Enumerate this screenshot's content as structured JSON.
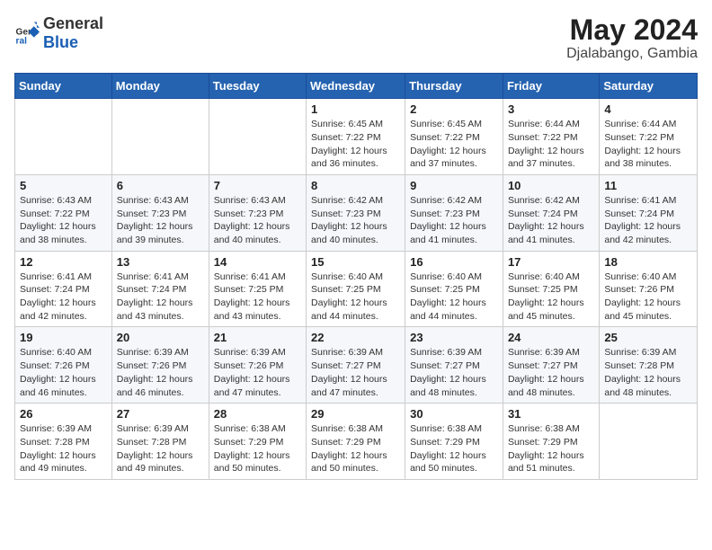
{
  "header": {
    "logo_general": "General",
    "logo_blue": "Blue",
    "month_year": "May 2024",
    "location": "Djalabango, Gambia"
  },
  "weekdays": [
    "Sunday",
    "Monday",
    "Tuesday",
    "Wednesday",
    "Thursday",
    "Friday",
    "Saturday"
  ],
  "weeks": [
    [
      {
        "day": "",
        "info": ""
      },
      {
        "day": "",
        "info": ""
      },
      {
        "day": "",
        "info": ""
      },
      {
        "day": "1",
        "sunrise": "6:45 AM",
        "sunset": "7:22 PM",
        "daylight": "12 hours and 36 minutes."
      },
      {
        "day": "2",
        "sunrise": "6:45 AM",
        "sunset": "7:22 PM",
        "daylight": "12 hours and 37 minutes."
      },
      {
        "day": "3",
        "sunrise": "6:44 AM",
        "sunset": "7:22 PM",
        "daylight": "12 hours and 37 minutes."
      },
      {
        "day": "4",
        "sunrise": "6:44 AM",
        "sunset": "7:22 PM",
        "daylight": "12 hours and 38 minutes."
      }
    ],
    [
      {
        "day": "5",
        "sunrise": "6:43 AM",
        "sunset": "7:22 PM",
        "daylight": "12 hours and 38 minutes."
      },
      {
        "day": "6",
        "sunrise": "6:43 AM",
        "sunset": "7:23 PM",
        "daylight": "12 hours and 39 minutes."
      },
      {
        "day": "7",
        "sunrise": "6:43 AM",
        "sunset": "7:23 PM",
        "daylight": "12 hours and 40 minutes."
      },
      {
        "day": "8",
        "sunrise": "6:42 AM",
        "sunset": "7:23 PM",
        "daylight": "12 hours and 40 minutes."
      },
      {
        "day": "9",
        "sunrise": "6:42 AM",
        "sunset": "7:23 PM",
        "daylight": "12 hours and 41 minutes."
      },
      {
        "day": "10",
        "sunrise": "6:42 AM",
        "sunset": "7:24 PM",
        "daylight": "12 hours and 41 minutes."
      },
      {
        "day": "11",
        "sunrise": "6:41 AM",
        "sunset": "7:24 PM",
        "daylight": "12 hours and 42 minutes."
      }
    ],
    [
      {
        "day": "12",
        "sunrise": "6:41 AM",
        "sunset": "7:24 PM",
        "daylight": "12 hours and 42 minutes."
      },
      {
        "day": "13",
        "sunrise": "6:41 AM",
        "sunset": "7:24 PM",
        "daylight": "12 hours and 43 minutes."
      },
      {
        "day": "14",
        "sunrise": "6:41 AM",
        "sunset": "7:25 PM",
        "daylight": "12 hours and 43 minutes."
      },
      {
        "day": "15",
        "sunrise": "6:40 AM",
        "sunset": "7:25 PM",
        "daylight": "12 hours and 44 minutes."
      },
      {
        "day": "16",
        "sunrise": "6:40 AM",
        "sunset": "7:25 PM",
        "daylight": "12 hours and 44 minutes."
      },
      {
        "day": "17",
        "sunrise": "6:40 AM",
        "sunset": "7:25 PM",
        "daylight": "12 hours and 45 minutes."
      },
      {
        "day": "18",
        "sunrise": "6:40 AM",
        "sunset": "7:26 PM",
        "daylight": "12 hours and 45 minutes."
      }
    ],
    [
      {
        "day": "19",
        "sunrise": "6:40 AM",
        "sunset": "7:26 PM",
        "daylight": "12 hours and 46 minutes."
      },
      {
        "day": "20",
        "sunrise": "6:39 AM",
        "sunset": "7:26 PM",
        "daylight": "12 hours and 46 minutes."
      },
      {
        "day": "21",
        "sunrise": "6:39 AM",
        "sunset": "7:26 PM",
        "daylight": "12 hours and 47 minutes."
      },
      {
        "day": "22",
        "sunrise": "6:39 AM",
        "sunset": "7:27 PM",
        "daylight": "12 hours and 47 minutes."
      },
      {
        "day": "23",
        "sunrise": "6:39 AM",
        "sunset": "7:27 PM",
        "daylight": "12 hours and 48 minutes."
      },
      {
        "day": "24",
        "sunrise": "6:39 AM",
        "sunset": "7:27 PM",
        "daylight": "12 hours and 48 minutes."
      },
      {
        "day": "25",
        "sunrise": "6:39 AM",
        "sunset": "7:28 PM",
        "daylight": "12 hours and 48 minutes."
      }
    ],
    [
      {
        "day": "26",
        "sunrise": "6:39 AM",
        "sunset": "7:28 PM",
        "daylight": "12 hours and 49 minutes."
      },
      {
        "day": "27",
        "sunrise": "6:39 AM",
        "sunset": "7:28 PM",
        "daylight": "12 hours and 49 minutes."
      },
      {
        "day": "28",
        "sunrise": "6:38 AM",
        "sunset": "7:29 PM",
        "daylight": "12 hours and 50 minutes."
      },
      {
        "day": "29",
        "sunrise": "6:38 AM",
        "sunset": "7:29 PM",
        "daylight": "12 hours and 50 minutes."
      },
      {
        "day": "30",
        "sunrise": "6:38 AM",
        "sunset": "7:29 PM",
        "daylight": "12 hours and 50 minutes."
      },
      {
        "day": "31",
        "sunrise": "6:38 AM",
        "sunset": "7:29 PM",
        "daylight": "12 hours and 51 minutes."
      },
      {
        "day": "",
        "info": ""
      }
    ]
  ]
}
